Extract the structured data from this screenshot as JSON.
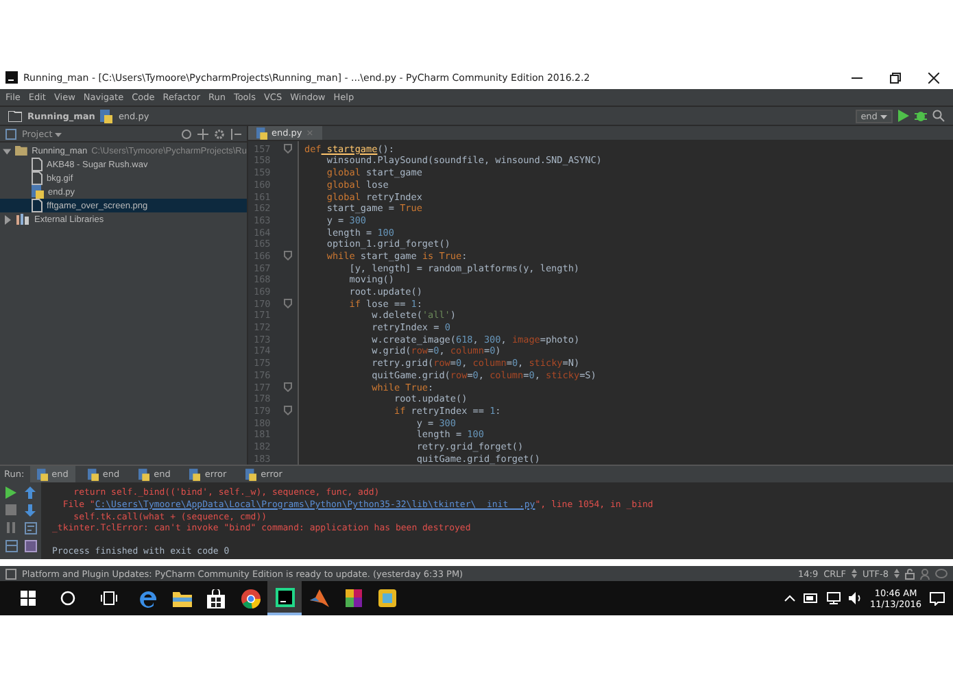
{
  "window": {
    "title": "Running_man - [C:\\Users\\Tymoore\\PycharmProjects\\Running_man] - ...\\end.py - PyCharm Community Edition 2016.2.2"
  },
  "menu": [
    "File",
    "Edit",
    "View",
    "Navigate",
    "Code",
    "Refactor",
    "Run",
    "Tools",
    "VCS",
    "Window",
    "Help"
  ],
  "breadcrumbs": [
    "Running_man",
    "end.py"
  ],
  "run_config": "end",
  "project_panel": {
    "title": "Project",
    "tree": [
      {
        "label": "Running_man",
        "path": "C:\\Users\\Tymoore\\PycharmProjects\\Ru",
        "kind": "folder",
        "expanded": true,
        "selected": false,
        "children": [
          {
            "label": "AKB48 - Sugar Rush.wav",
            "kind": "file",
            "selected": false
          },
          {
            "label": "bkg.gif",
            "kind": "file",
            "selected": false
          },
          {
            "label": "end.py",
            "kind": "python",
            "selected": false
          },
          {
            "label": "fftgame_over_screen.png",
            "kind": "file",
            "selected": true
          }
        ]
      },
      {
        "label": "External Libraries",
        "kind": "library",
        "expanded": false,
        "selected": false
      }
    ]
  },
  "editor": {
    "tabs": [
      {
        "label": "end.py",
        "close": "×",
        "selected": true
      }
    ],
    "lines": [
      {
        "number": "157",
        "fold": true,
        "tokens": [
          {
            "kind": "kw",
            "text": "def"
          },
          {
            "kind": "fn",
            "text": " startgame"
          },
          {
            "kind": "p",
            "text": "():"
          }
        ]
      },
      {
        "number": "158",
        "fold": false,
        "tokens": [
          {
            "kind": "p",
            "text": "    winsound.PlaySound(soundfile, winsound.SND_ASYNC)"
          }
        ]
      },
      {
        "number": "159",
        "fold": false,
        "tokens": [
          {
            "kind": "kw",
            "text": "    global"
          },
          {
            "kind": "p",
            "text": " start_game"
          }
        ]
      },
      {
        "number": "160",
        "fold": false,
        "tokens": [
          {
            "kind": "kw",
            "text": "    global"
          },
          {
            "kind": "p",
            "text": " lose"
          }
        ]
      },
      {
        "number": "161",
        "fold": false,
        "tokens": [
          {
            "kind": "kw",
            "text": "    global"
          },
          {
            "kind": "p",
            "text": " retryIndex"
          }
        ]
      },
      {
        "number": "162",
        "fold": false,
        "tokens": [
          {
            "kind": "p",
            "text": "    start_game = "
          },
          {
            "kind": "kw",
            "text": "True"
          }
        ]
      },
      {
        "number": "163",
        "fold": false,
        "tokens": [
          {
            "kind": "p",
            "text": "    y = "
          },
          {
            "kind": "num",
            "text": "300"
          }
        ]
      },
      {
        "number": "164",
        "fold": false,
        "tokens": [
          {
            "kind": "p",
            "text": "    length = "
          },
          {
            "kind": "num",
            "text": "100"
          }
        ]
      },
      {
        "number": "165",
        "fold": false,
        "tokens": [
          {
            "kind": "p",
            "text": "    option_1.grid_forget()"
          }
        ]
      },
      {
        "number": "166",
        "fold": true,
        "tokens": [
          {
            "kind": "kw",
            "text": "    while"
          },
          {
            "kind": "p",
            "text": " start_game "
          },
          {
            "kind": "kw",
            "text": "is True"
          },
          {
            "kind": "p",
            "text": ":"
          }
        ]
      },
      {
        "number": "167",
        "fold": false,
        "tokens": [
          {
            "kind": "p",
            "text": "        [y, length] = random_platforms(y, length)"
          }
        ]
      },
      {
        "number": "168",
        "fold": false,
        "tokens": [
          {
            "kind": "p",
            "text": "        moving()"
          }
        ]
      },
      {
        "number": "169",
        "fold": false,
        "tokens": [
          {
            "kind": "p",
            "text": "        root.update()"
          }
        ]
      },
      {
        "number": "170",
        "fold": true,
        "tokens": [
          {
            "kind": "kw",
            "text": "        if"
          },
          {
            "kind": "p",
            "text": " lose == "
          },
          {
            "kind": "num",
            "text": "1"
          },
          {
            "kind": "p",
            "text": ":"
          }
        ]
      },
      {
        "number": "171",
        "fold": false,
        "tokens": [
          {
            "kind": "p",
            "text": "            w.delete("
          },
          {
            "kind": "str",
            "text": "'all'"
          },
          {
            "kind": "p",
            "text": ")"
          }
        ]
      },
      {
        "number": "172",
        "fold": false,
        "tokens": [
          {
            "kind": "p",
            "text": "            retryIndex = "
          },
          {
            "kind": "num",
            "text": "0"
          }
        ]
      },
      {
        "number": "173",
        "fold": false,
        "tokens": [
          {
            "kind": "p",
            "text": "            w.create_image("
          },
          {
            "kind": "num",
            "text": "618"
          },
          {
            "kind": "p",
            "text": ", "
          },
          {
            "kind": "num",
            "text": "300"
          },
          {
            "kind": "p",
            "text": ", "
          },
          {
            "kind": "param",
            "text": "image"
          },
          {
            "kind": "p",
            "text": "=photo)"
          }
        ]
      },
      {
        "number": "174",
        "fold": false,
        "tokens": [
          {
            "kind": "p",
            "text": "            w.grid("
          },
          {
            "kind": "param",
            "text": "row"
          },
          {
            "kind": "p",
            "text": "="
          },
          {
            "kind": "num",
            "text": "0"
          },
          {
            "kind": "p",
            "text": ", "
          },
          {
            "kind": "param",
            "text": "column"
          },
          {
            "kind": "p",
            "text": "="
          },
          {
            "kind": "num",
            "text": "0"
          },
          {
            "kind": "p",
            "text": ")"
          }
        ]
      },
      {
        "number": "175",
        "fold": false,
        "tokens": [
          {
            "kind": "p",
            "text": "            retry.grid("
          },
          {
            "kind": "param",
            "text": "row"
          },
          {
            "kind": "p",
            "text": "="
          },
          {
            "kind": "num",
            "text": "0"
          },
          {
            "kind": "p",
            "text": ", "
          },
          {
            "kind": "param",
            "text": "column"
          },
          {
            "kind": "p",
            "text": "="
          },
          {
            "kind": "num",
            "text": "0"
          },
          {
            "kind": "p",
            "text": ", "
          },
          {
            "kind": "param",
            "text": "sticky"
          },
          {
            "kind": "p",
            "text": "=N)"
          }
        ]
      },
      {
        "number": "176",
        "fold": false,
        "tokens": [
          {
            "kind": "p",
            "text": "            quitGame.grid("
          },
          {
            "kind": "param",
            "text": "row"
          },
          {
            "kind": "p",
            "text": "="
          },
          {
            "kind": "num",
            "text": "0"
          },
          {
            "kind": "p",
            "text": ", "
          },
          {
            "kind": "param",
            "text": "column"
          },
          {
            "kind": "p",
            "text": "="
          },
          {
            "kind": "num",
            "text": "0"
          },
          {
            "kind": "p",
            "text": ", "
          },
          {
            "kind": "param",
            "text": "sticky"
          },
          {
            "kind": "p",
            "text": "=S)"
          }
        ]
      },
      {
        "number": "177",
        "fold": true,
        "tokens": [
          {
            "kind": "kw",
            "text": "            while True"
          },
          {
            "kind": "p",
            "text": ":"
          }
        ]
      },
      {
        "number": "178",
        "fold": false,
        "tokens": [
          {
            "kind": "p",
            "text": "                root.update()"
          }
        ]
      },
      {
        "number": "179",
        "fold": true,
        "tokens": [
          {
            "kind": "kw",
            "text": "                if"
          },
          {
            "kind": "p",
            "text": " retryIndex == "
          },
          {
            "kind": "num",
            "text": "1"
          },
          {
            "kind": "p",
            "text": ":"
          }
        ]
      },
      {
        "number": "180",
        "fold": false,
        "tokens": [
          {
            "kind": "p",
            "text": "                    y = "
          },
          {
            "kind": "num",
            "text": "300"
          }
        ]
      },
      {
        "number": "181",
        "fold": false,
        "tokens": [
          {
            "kind": "p",
            "text": "                    length = "
          },
          {
            "kind": "num",
            "text": "100"
          }
        ]
      },
      {
        "number": "182",
        "fold": false,
        "tokens": [
          {
            "kind": "p",
            "text": "                    retry.grid_forget()"
          }
        ]
      },
      {
        "number": "183",
        "fold": false,
        "tokens": [
          {
            "kind": "p",
            "text": "                    quitGame.grid_forget()"
          }
        ]
      }
    ]
  },
  "run_panel": {
    "label": "Run:",
    "tabs": [
      {
        "label": "end",
        "selected": true
      },
      {
        "label": "end",
        "selected": false
      },
      {
        "label": "end",
        "selected": false
      },
      {
        "label": "error",
        "selected": false
      },
      {
        "label": "error",
        "selected": false
      }
    ],
    "output": [
      {
        "kind": "error",
        "text": "    return self._bind(('bind', self._w), sequence, func, add)"
      },
      {
        "kind": "file",
        "text": "  File \"",
        "link": "C:\\Users\\Tymoore\\AppData\\Local\\Programs\\Python\\Python35-32\\lib\\tkinter\\__init__.py",
        "suffix": "\", line 1054, in _bind"
      },
      {
        "kind": "error",
        "text": "    self.tk.call(what + (sequence, cmd))"
      },
      {
        "kind": "error",
        "text": "_tkinter.TclError: can't invoke \"bind\" command: application has been destroyed"
      },
      {
        "kind": "info",
        "text": "Process finished with exit code 0"
      }
    ]
  },
  "status_bar": {
    "message": "Platform and Plugin Updates: PyCharm Community Edition is ready to update. (yesterday 6:33 PM)",
    "position": "14:9",
    "line_separator": "CRLF",
    "encoding": "UTF-8"
  },
  "taskbar": {
    "apps": [
      {
        "kind": "edge",
        "active": false
      },
      {
        "kind": "explorer",
        "active": false
      },
      {
        "kind": "store",
        "active": false
      },
      {
        "kind": "chrome",
        "active": false
      },
      {
        "kind": "pycharm",
        "active": true
      },
      {
        "kind": "matlab",
        "active": false
      },
      {
        "kind": "tiles",
        "active": false
      },
      {
        "kind": "box",
        "active": false
      }
    ],
    "time": "10:46 AM",
    "date": "11/13/2016"
  }
}
